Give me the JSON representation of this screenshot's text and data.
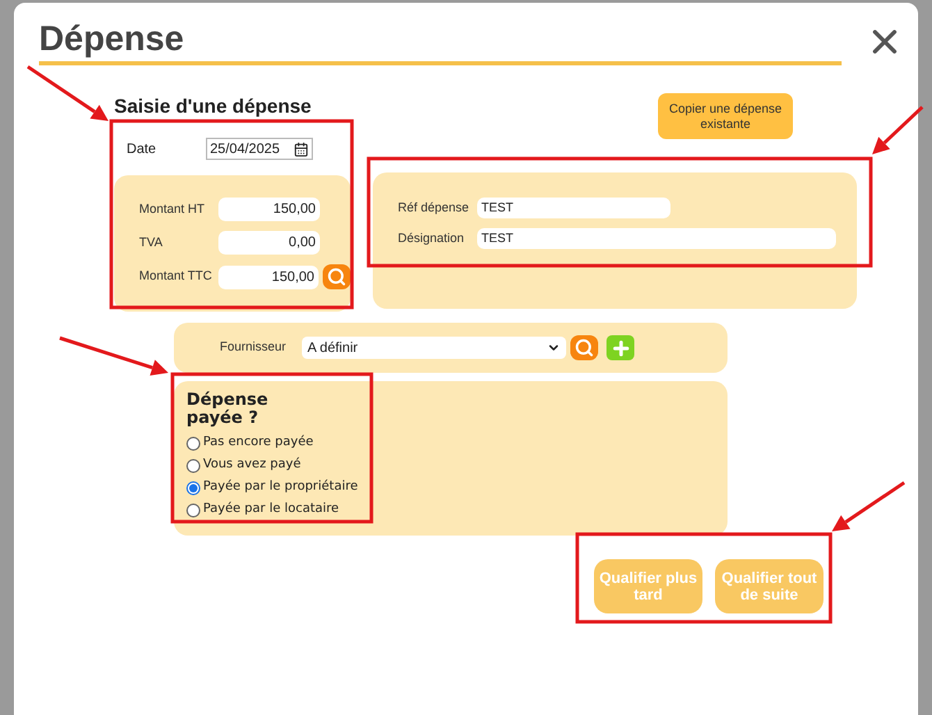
{
  "title": "Dépense",
  "section_title": "Saisie d'une dépense",
  "copy_button": "Copier une dépense existante",
  "date": {
    "label": "Date",
    "value": "25/04/2025"
  },
  "amounts": [
    {
      "label": "Montant HT",
      "value": "150,00"
    },
    {
      "label": "TVA",
      "value": "0,00"
    },
    {
      "label": "Montant TTC",
      "value": "150,00"
    }
  ],
  "reference": [
    {
      "label": "Réf dépense",
      "value": "TEST",
      "kind": "short"
    },
    {
      "label": "Désignation",
      "value": "TEST",
      "kind": "long"
    }
  ],
  "supplier": {
    "label": "Fournisseur",
    "value": "A définir"
  },
  "payment": {
    "title": "Dépense payée ?",
    "options": [
      {
        "label": "Pas encore payée",
        "selected": false
      },
      {
        "label": "Vous avez payé",
        "selected": false
      },
      {
        "label": "Payée par le propriétaire",
        "selected": true
      },
      {
        "label": "Payée par le locataire",
        "selected": false
      }
    ]
  },
  "buttons": [
    "Qualifier plus tard",
    "Qualifier tout de suite"
  ]
}
